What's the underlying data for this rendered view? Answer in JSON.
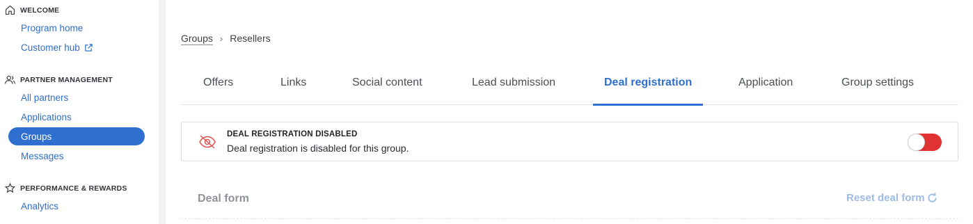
{
  "sidebar": {
    "sections": [
      {
        "heading": "WELCOME",
        "icon": "home-icon",
        "items": [
          {
            "label": "Program home"
          },
          {
            "label": "Customer hub",
            "external": true
          }
        ]
      },
      {
        "heading": "PARTNER MANAGEMENT",
        "icon": "users-icon",
        "items": [
          {
            "label": "All partners"
          },
          {
            "label": "Applications"
          },
          {
            "label": "Groups",
            "active": true
          },
          {
            "label": "Messages"
          }
        ]
      },
      {
        "heading": "PERFORMANCE & REWARDS",
        "icon": "star-icon",
        "items": [
          {
            "label": "Analytics"
          }
        ]
      }
    ]
  },
  "breadcrumb": {
    "parent": "Groups",
    "separator": "›",
    "current": "Resellers"
  },
  "tabs": [
    {
      "label": "Offers"
    },
    {
      "label": "Links"
    },
    {
      "label": "Social content"
    },
    {
      "label": "Lead submission"
    },
    {
      "label": "Deal registration",
      "active": true
    },
    {
      "label": "Application"
    },
    {
      "label": "Group settings"
    }
  ],
  "notice": {
    "icon": "eye-off-icon",
    "title": "DEAL REGISTRATION DISABLED",
    "text": "Deal registration is disabled for this group.",
    "toggle_on": false
  },
  "deal_form": {
    "label": "Deal form",
    "reset_label": "Reset deal form"
  },
  "colors": {
    "accent": "#2f6fd0",
    "danger": "#e03232",
    "link": "#2f6fca"
  }
}
